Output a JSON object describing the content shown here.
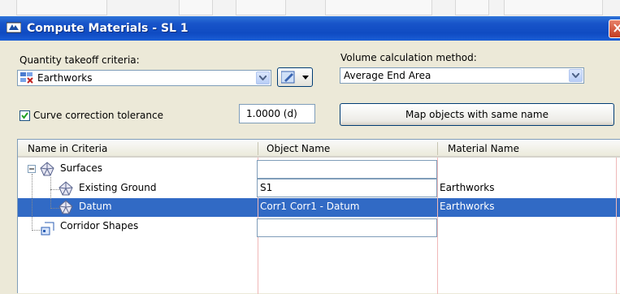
{
  "window": {
    "title": "Compute Materials - SL 1"
  },
  "criteria": {
    "label": "Quantity takeoff criteria:",
    "value": "Earthworks"
  },
  "volume": {
    "label": "Volume calculation method:",
    "value": "Average End Area"
  },
  "curve": {
    "checked": true,
    "label": "Curve correction tolerance",
    "value": "1.0000 (d)"
  },
  "map_button": {
    "label": "Map objects with same name"
  },
  "table": {
    "headers": [
      "Name in Criteria",
      "Object Name",
      "Material Name"
    ],
    "rows": [
      {
        "name": "Surfaces",
        "object": "",
        "material": "",
        "icon": "surface-icon",
        "expander": "minus"
      },
      {
        "name": "Existing Ground",
        "object": "S1",
        "material": "Earthworks",
        "icon": "surface-icon"
      },
      {
        "name": "Datum",
        "object": "Corr1 Corr1 - Datum",
        "material": "Earthworks",
        "icon": "surface-icon",
        "selected": true
      },
      {
        "name": "Corridor Shapes",
        "object": "",
        "material": "",
        "icon": "corridor-shapes-icon"
      }
    ]
  },
  "colors": {
    "titlebar": "#0f4bc2",
    "selection": "#316ac5",
    "dialog_bg": "#ece9d8"
  }
}
